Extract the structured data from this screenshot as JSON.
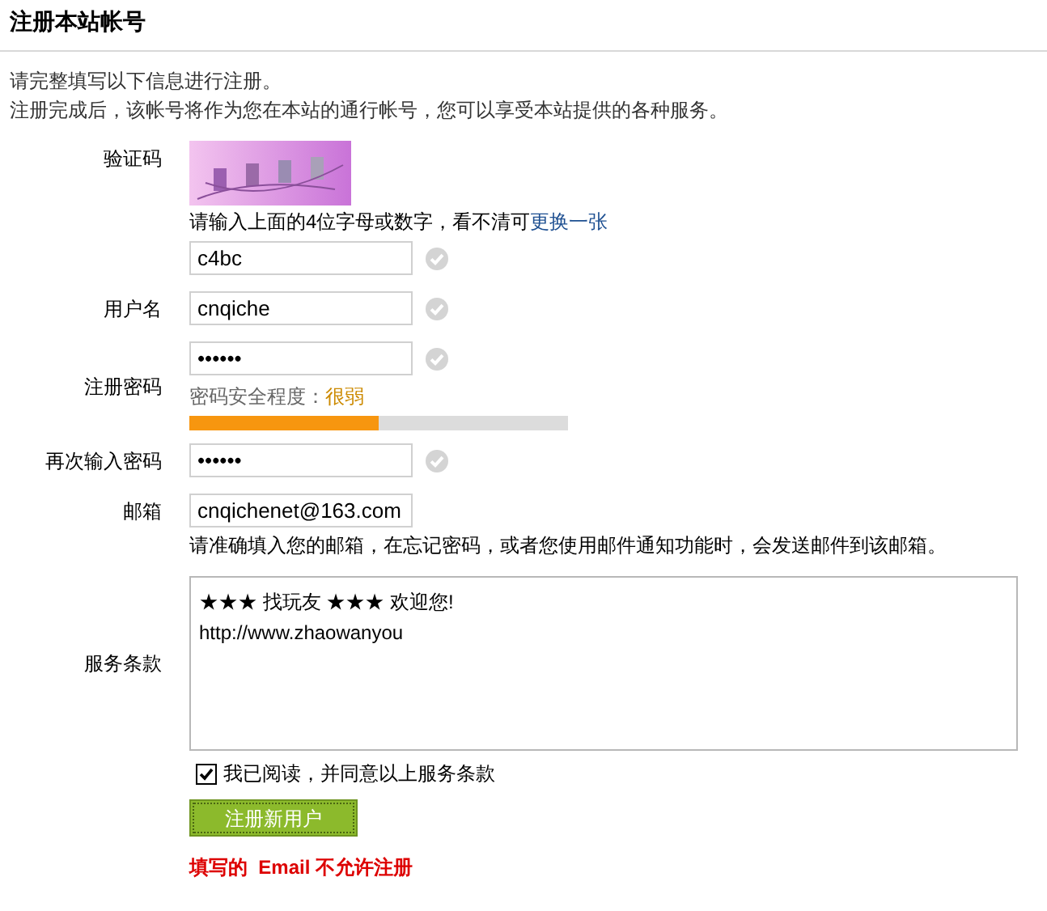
{
  "title": "注册本站帐号",
  "intro": [
    "请完整填写以下信息进行注册。",
    "注册完成后，该帐号将作为您在本站的通行帐号，您可以享受本站提供的各种服务。"
  ],
  "captcha": {
    "label": "验证码",
    "hint": "请输入上面的4位字母或数字，看不清可",
    "link": "更换一张",
    "value": "c4bc",
    "valid": true
  },
  "fields": [
    {
      "kind": "text",
      "label": "用户名",
      "value": "cnqiche",
      "valid": true
    },
    {
      "kind": "password",
      "label": "注册密码",
      "value": "••••••",
      "valid": true,
      "strength_label": "密码安全程度：",
      "strength": "很弱",
      "level": 0.5
    },
    {
      "kind": "text",
      "label": "再次输入密码",
      "value": "••••••",
      "valid": true
    },
    {
      "kind": "email",
      "label": "邮箱",
      "value": "cnqichenet@163.com",
      "hint": "请准确填入您的邮箱，在忘记密码，或者您使用邮件通知功能时，会发送邮件到该邮箱。"
    }
  ],
  "terms": {
    "label": "服务条款",
    "lines": [
      "★★★ 找玩友 ★★★ 欢迎您!",
      "http://www.zhaowanyou"
    ]
  },
  "agree": {
    "label": "我已阅读，并同意以上服务条款",
    "checked": true
  },
  "submit": "注册新用户",
  "error": "填写的  Email 不允许注册"
}
